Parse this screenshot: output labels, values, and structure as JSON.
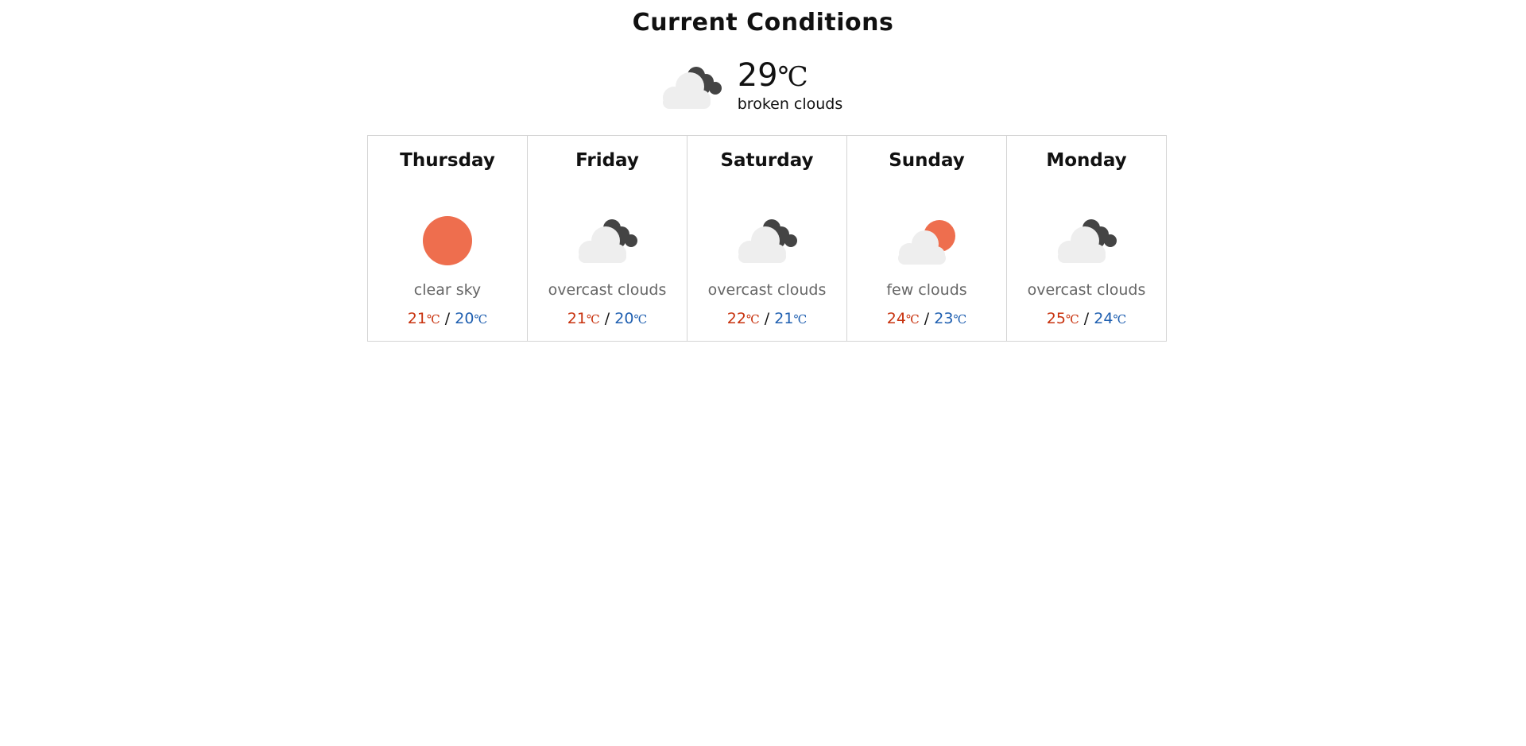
{
  "page": {
    "title": "Current Conditions"
  },
  "current": {
    "temp": "29",
    "unit": "℃",
    "description": "broken clouds",
    "icon": "broken-clouds-icon"
  },
  "colors": {
    "high": "#c8320e",
    "low": "#1f5fb0",
    "sun": "#ee6e4e",
    "dark_cloud": "#444444",
    "light_cloud": "#eeeeee"
  },
  "forecast": [
    {
      "day": "Thursday",
      "condition": "clear sky",
      "icon": "clear-sky-icon",
      "high": "21",
      "low": "20",
      "unit": "℃"
    },
    {
      "day": "Friday",
      "condition": "overcast clouds",
      "icon": "overcast-clouds-icon",
      "high": "21",
      "low": "20",
      "unit": "℃"
    },
    {
      "day": "Saturday",
      "condition": "overcast clouds",
      "icon": "overcast-clouds-icon",
      "high": "22",
      "low": "21",
      "unit": "℃"
    },
    {
      "day": "Sunday",
      "condition": "few clouds",
      "icon": "few-clouds-icon",
      "high": "24",
      "low": "23",
      "unit": "℃"
    },
    {
      "day": "Monday",
      "condition": "overcast clouds",
      "icon": "overcast-clouds-icon",
      "high": "25",
      "low": "24",
      "unit": "℃"
    }
  ],
  "separator": "/"
}
